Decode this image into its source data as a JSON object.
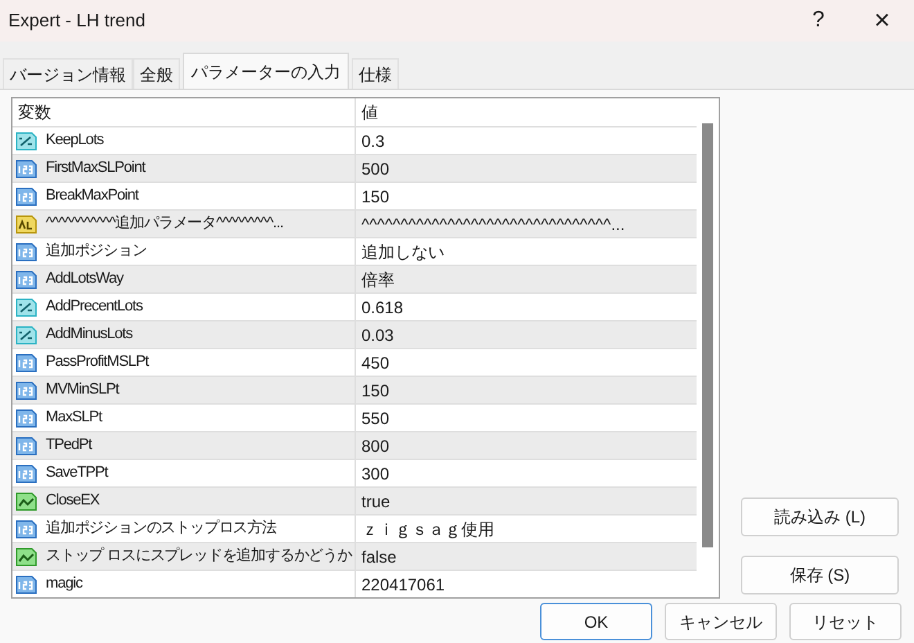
{
  "window": {
    "title": "Expert - LH trend",
    "help": "?",
    "close": "×"
  },
  "tabs": [
    {
      "label": "バージョン情報",
      "selected": false
    },
    {
      "label": "全般",
      "selected": false
    },
    {
      "label": "パラメーターの入力",
      "selected": true
    },
    {
      "label": "仕様",
      "selected": false
    }
  ],
  "table": {
    "columns": [
      "変数",
      "値"
    ],
    "rows": [
      {
        "kind": "double",
        "name": "KeepLots",
        "value": "0.3"
      },
      {
        "kind": "int",
        "name": "FirstMaxSLPoint",
        "value": "500"
      },
      {
        "kind": "int",
        "name": "BreakMaxPoint",
        "value": "150"
      },
      {
        "kind": "string",
        "name": "^^^^^^^^^^^追加パラメータ^^^^^^^^^...",
        "value": "^^^^^^^^^^^^^^^^^^^^^^^^^^^^^^^^..."
      },
      {
        "kind": "int",
        "name": "追加ポジション",
        "value": "追加しない"
      },
      {
        "kind": "int",
        "name": "AddLotsWay",
        "value": "倍率"
      },
      {
        "kind": "double",
        "name": "AddPrecentLots",
        "value": "0.618"
      },
      {
        "kind": "double",
        "name": "AddMinusLots",
        "value": "0.03"
      },
      {
        "kind": "int",
        "name": "PassProfitMSLPt",
        "value": "450"
      },
      {
        "kind": "int",
        "name": "MVMinSLPt",
        "value": "150"
      },
      {
        "kind": "int",
        "name": "MaxSLPt",
        "value": "550"
      },
      {
        "kind": "int",
        "name": "TPedPt",
        "value": "800"
      },
      {
        "kind": "int",
        "name": "SaveTPPt",
        "value": "300"
      },
      {
        "kind": "bool",
        "name": "CloseEX",
        "value": "true"
      },
      {
        "kind": "int",
        "name": "追加ポジションのストップロス方法",
        "value": "ｚｉｇｓａｇ使用"
      },
      {
        "kind": "bool",
        "name": "ストップ ロスにスプレッドを追加するかどうか",
        "value": "false"
      },
      {
        "kind": "int",
        "name": "magic",
        "value": "220417061"
      }
    ]
  },
  "side_buttons": [
    "読み込み (L)",
    "保存 (S)"
  ],
  "buttons": [
    {
      "label": "OK",
      "selected": true
    },
    {
      "label": "キャンセル",
      "selected": false
    },
    {
      "label": "リセット",
      "selected": false
    }
  ]
}
